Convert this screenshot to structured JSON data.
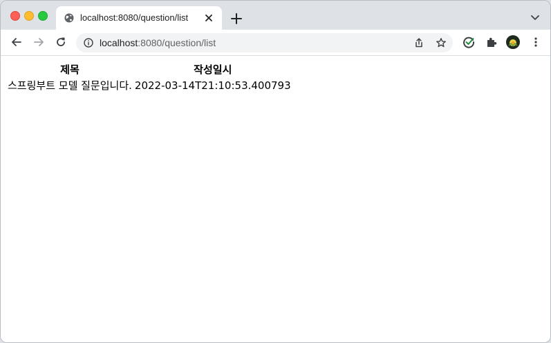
{
  "browser": {
    "tab": {
      "title": "localhost:8080/question/list",
      "favicon": "globe-icon"
    },
    "address": {
      "host": "localhost",
      "rest": ":8080/question/list"
    }
  },
  "page": {
    "table": {
      "headers": [
        "제목",
        "작성일시"
      ],
      "rows": [
        {
          "subject": "스프링부트 모델 질문입니다.",
          "created": "2022-03-14T21:10:53.400793"
        }
      ]
    }
  }
}
